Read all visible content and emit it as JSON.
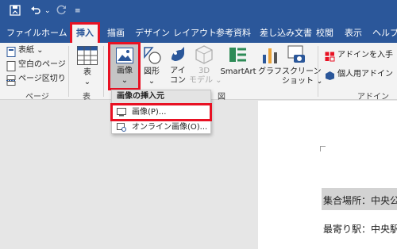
{
  "quick_access": {
    "more": "≡"
  },
  "tabs": [
    {
      "label": "ファイル"
    },
    {
      "label": "ホーム"
    },
    {
      "label": "挿入"
    },
    {
      "label": "描画"
    },
    {
      "label": "デザイン"
    },
    {
      "label": "レイアウト"
    },
    {
      "label": "参考資料"
    },
    {
      "label": "差し込み文書"
    },
    {
      "label": "校閲"
    },
    {
      "label": "表示"
    },
    {
      "label": "ヘルプ"
    }
  ],
  "ribbon": {
    "pages": {
      "cover": "表紙",
      "blank": "空白のページ",
      "break": "ページ区切り",
      "group": "ページ"
    },
    "table": {
      "label": "表",
      "group": "表"
    },
    "images": {
      "picture": "画像",
      "shapes": "図形",
      "icons1": "アイ",
      "icons2": "コン",
      "model1": "3D",
      "model2": "モデル",
      "smartart": "SmartArt",
      "chart": "グラフ",
      "screenshot1": "スクリーン",
      "screenshot2": "ショット",
      "group": "図"
    },
    "addins": {
      "get": "アドインを入手",
      "personal": "個人用アドイン",
      "group": "アドイン"
    }
  },
  "dropdown": {
    "header": "画像の挿入元",
    "picture": "画像(P)...",
    "online": "オンライン画像(O)..."
  },
  "document": {
    "line1": "集合場所：中央公",
    "line2": "最寄り駅：中央駅"
  },
  "colors": {
    "titlebar": "#2b579a",
    "highlight": "#e81123"
  }
}
